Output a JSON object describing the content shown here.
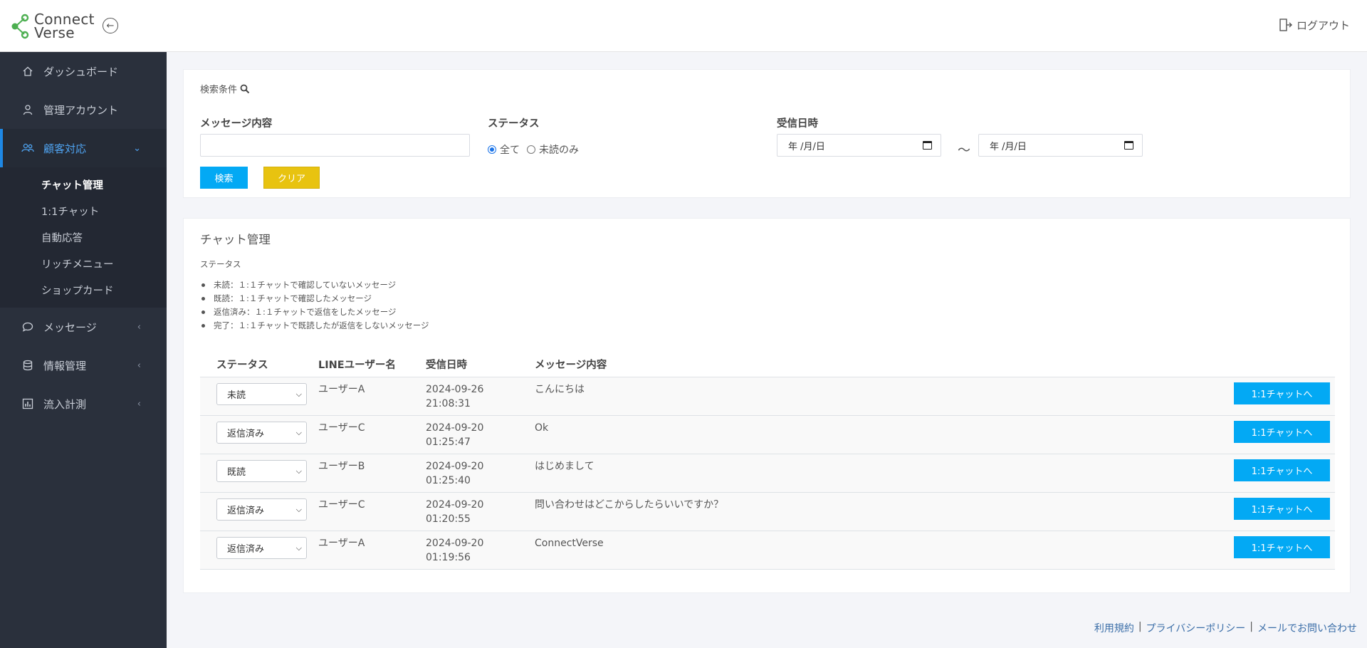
{
  "header": {
    "logo_line1": "Connect",
    "logo_line2": "Verse",
    "logout_label": "ログアウト",
    "brand_green": "#4caf50"
  },
  "sidebar": {
    "items": [
      {
        "label": "ダッシュボード",
        "icon": "home-icon"
      },
      {
        "label": "管理アカウント",
        "icon": "user-icon"
      },
      {
        "label": "顧客対応",
        "icon": "users-icon",
        "active": true
      },
      {
        "label": "メッセージ",
        "icon": "chat-bubble-icon"
      },
      {
        "label": "情報管理",
        "icon": "database-icon"
      },
      {
        "label": "流入計測",
        "icon": "bar-chart-icon"
      }
    ],
    "subitems": [
      {
        "label": "チャット管理",
        "current": true
      },
      {
        "label": "1:1チャット"
      },
      {
        "label": "自動応答"
      },
      {
        "label": "リッチメニュー"
      },
      {
        "label": "ショップカード"
      }
    ]
  },
  "search": {
    "title": "検索条件",
    "message_label": "メッセージ内容",
    "message_value": "",
    "status_label": "ステータス",
    "radio_all": "全て",
    "radio_unread": "未読のみ",
    "selected_radio": "all",
    "date_label": "受信日時",
    "date_from": "年 /月/日",
    "date_to": "年 /月/日",
    "tilde": "～",
    "search_button": "検索",
    "clear_button": "クリア"
  },
  "list": {
    "title": "チャット管理",
    "status_heading": "ステータス",
    "legend": [
      "未読：１:１チャットで確認していないメッセージ",
      "既読：１:１チャットで確認したメッセージ",
      "返信済み：１:１チャットで返信をしたメッセージ",
      "完了：１:１チャットで既読したが返信をしないメッセージ"
    ],
    "columns": [
      "ステータス",
      "LINEユーザー名",
      "受信日時",
      "メッセージ内容"
    ],
    "rows": [
      {
        "status": "未読",
        "user": "ユーザーA",
        "date": "2024-09-26",
        "time": "21:08:31",
        "message": "こんにちは",
        "action": "1:1チャットへ"
      },
      {
        "status": "返信済み",
        "user": "ユーザーC",
        "date": "2024-09-20",
        "time": "01:25:47",
        "message": "Ok",
        "action": "1:1チャットへ"
      },
      {
        "status": "既読",
        "user": "ユーザーB",
        "date": "2024-09-20",
        "time": "01:25:40",
        "message": "はじめまして",
        "action": "1:1チャットへ"
      },
      {
        "status": "返信済み",
        "user": "ユーザーC",
        "date": "2024-09-20",
        "time": "01:20:55",
        "message": "問い合わせはどこからしたらいいですか？",
        "action": "1:1チャットへ"
      },
      {
        "status": "返信済み",
        "user": "ユーザーA",
        "date": "2024-09-20",
        "time": "01:19:56",
        "message": "ConnectVerse",
        "action": "1:1チャットへ"
      }
    ]
  },
  "footer": {
    "links": [
      "利用規約",
      "プライバシーポリシー",
      "メールでお問い合わせ"
    ]
  }
}
